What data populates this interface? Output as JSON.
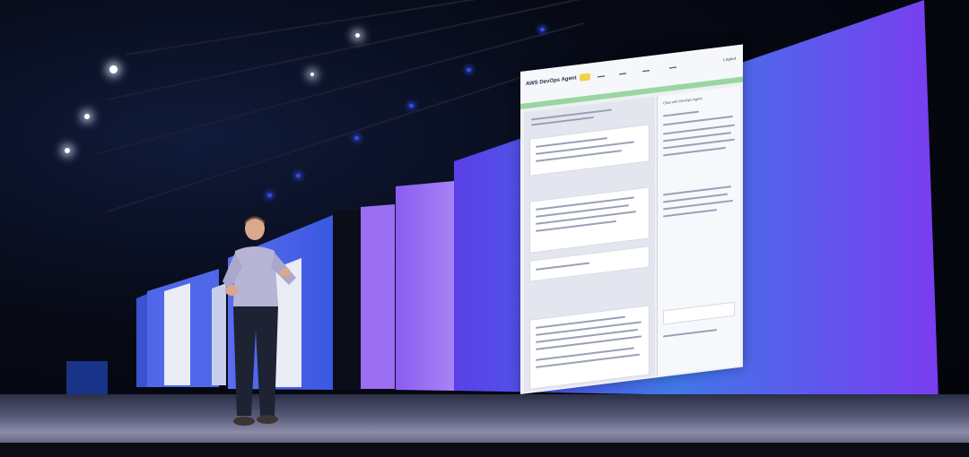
{
  "scene": {
    "description_colors": {
      "background": "#05060d",
      "screen_gradient_start": "#7a3cf0",
      "screen_gradient_end": "#3b73e6",
      "ui_background": "#eef0f6",
      "presenter_shirt": "#b7b4d6",
      "presenter_pants": "#1d2333"
    }
  },
  "ui": {
    "logo": "AWS DevOps Agent",
    "logout": "Logout",
    "sidebar_title": "Chat with DevOps Agent"
  }
}
